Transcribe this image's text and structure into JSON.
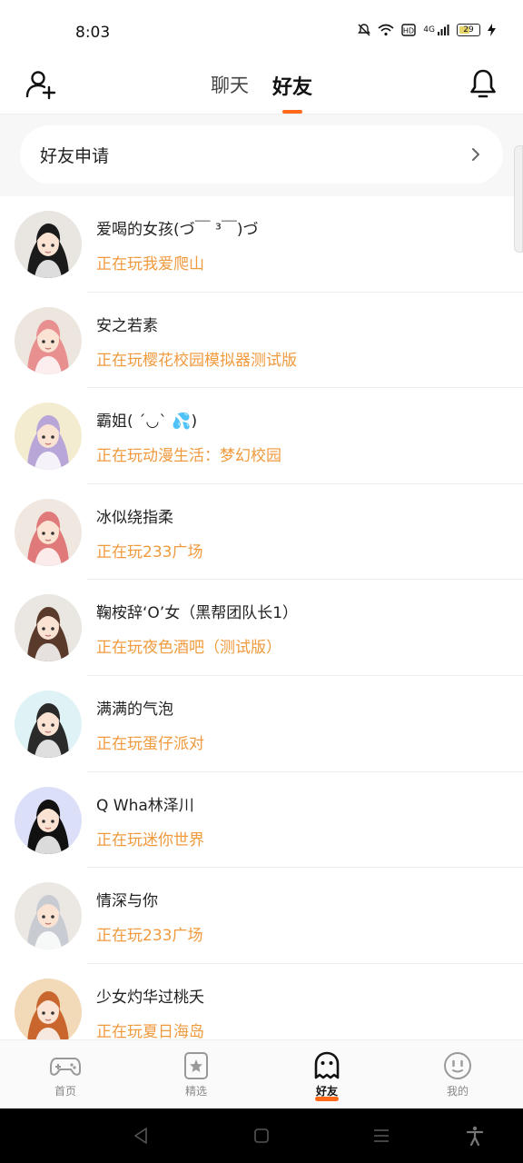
{
  "status_bar": {
    "time": "8:03",
    "signal": "4G",
    "battery": "29"
  },
  "header": {
    "tabs": [
      {
        "label": "聊天"
      },
      {
        "label": "好友"
      }
    ],
    "active_tab": "好友",
    "accent_color": "#ff6a1a"
  },
  "friend_request": {
    "label": "好友申请"
  },
  "friends": [
    {
      "name": "爱喝的女孩(づ￣ ³￣)づ",
      "status": "正在玩我爱爬山",
      "avatar_bg": "#e9e6e1",
      "hair": "#1b1b1b"
    },
    {
      "name": "安之若素",
      "status": "正在玩樱花校园模拟器测试版",
      "avatar_bg": "#ece6df",
      "hair": "#e88f90"
    },
    {
      "name": "霸姐(  ´◡`  💦)",
      "status": "正在玩动漫生活：梦幻校园",
      "avatar_bg": "#f3ecd0",
      "hair": "#b8a6d8"
    },
    {
      "name": "冰似绕指柔",
      "status": "正在玩233广场",
      "avatar_bg": "#efe7e0",
      "hair": "#e07a7a"
    },
    {
      "name": "鞠桉辞‘O’女（黑帮团队长1）",
      "status": "正在玩夜色酒吧（测试版）",
      "avatar_bg": "#eae6e1",
      "hair": "#5a3a2a"
    },
    {
      "name": "满满的气泡",
      "status": "正在玩蛋仔派对",
      "avatar_bg": "#dff2f6",
      "hair": "#2a2a2a"
    },
    {
      "name": "Q Wha林泽川",
      "status": "正在玩迷你世界",
      "avatar_bg": "#dcdff8",
      "hair": "#111111"
    },
    {
      "name": "情深与你",
      "status": "正在玩233广场",
      "avatar_bg": "#ebe8e4",
      "hair": "#c8ccd2"
    },
    {
      "name": "少女灼华过桃夭",
      "status": "正在玩夏日海岛",
      "avatar_bg": "#f2d9b8",
      "hair": "#c9662e"
    }
  ],
  "bottom_nav": [
    {
      "label": "首页",
      "icon": "gamepad-icon"
    },
    {
      "label": "精选",
      "icon": "star-card-icon"
    },
    {
      "label": "好友",
      "icon": "ghost-icon"
    },
    {
      "label": "我的",
      "icon": "smiley-icon"
    }
  ],
  "active_nav": "好友"
}
